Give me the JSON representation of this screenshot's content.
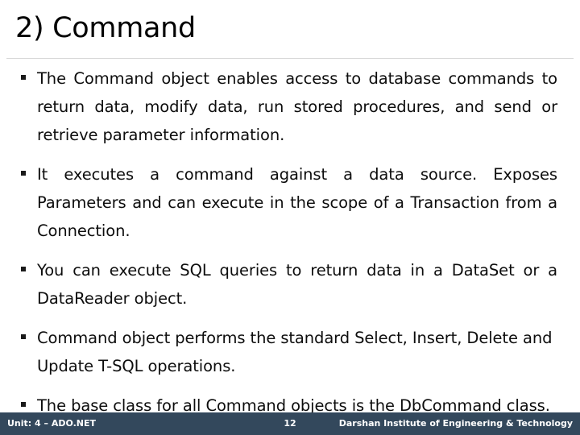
{
  "slide": {
    "title": "2) Command",
    "bullets": [
      {
        "marker": "square-bullet",
        "text": "The Command object enables access to database commands to return data, modify data, run stored procedures, and send or retrieve parameter information."
      },
      {
        "marker": "square-bullet",
        "text": "It executes a command against a data source. Exposes Parameters and can execute in the scope of a Transaction from a Connection."
      },
      {
        "marker": "square-bullet",
        "text": "You can execute SQL queries to return data in a DataSet or a DataReader object."
      },
      {
        "marker": "square-bullet",
        "text": "Command object performs the standard Select, Insert, Delete and Update T-SQL operations."
      },
      {
        "marker": "square-bullet",
        "text": "The base class for all Command objects is the DbCommand class."
      }
    ]
  },
  "footer": {
    "unit_label": "Unit: 4 – ADO.NET",
    "page_number": "12",
    "institute": "Darshan Institute of Engineering & Technology",
    "background_color": "#33485c",
    "text_color": "#ffffff"
  },
  "theme": {
    "title_color": "#000000",
    "body_text_color": "#0d0d0d",
    "rule_color": "#d8d8d8",
    "slide_background": "#ffffff"
  }
}
